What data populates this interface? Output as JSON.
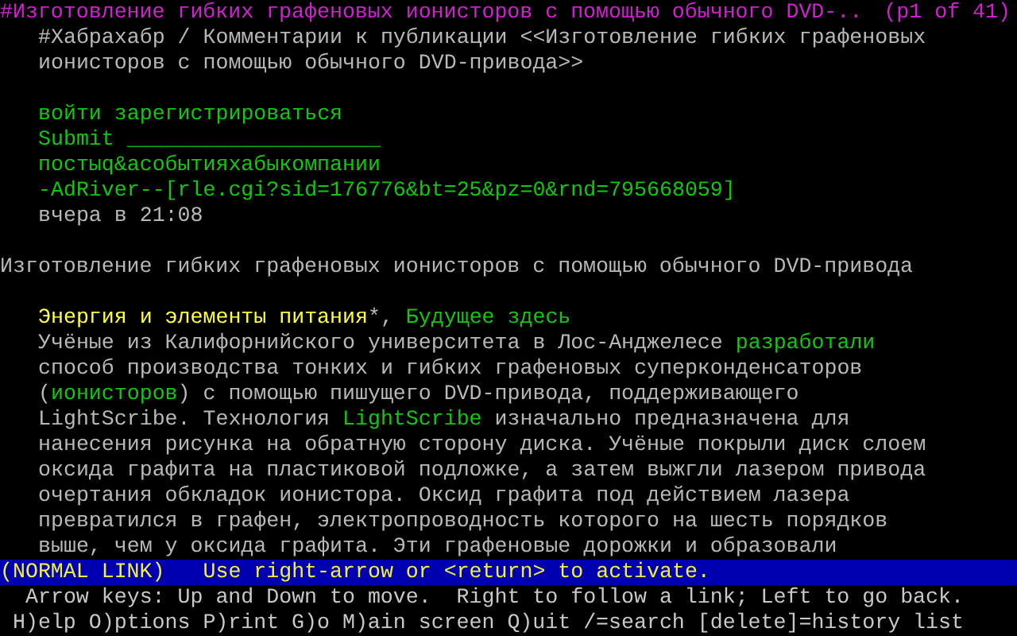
{
  "title_bar": {
    "title": "#Изготовление гибких графеновых ионисторов с помощью обычного DVD-..",
    "page": "(p1 of 41)"
  },
  "header": [
    "#Хабрахабр / Комментарии к публикации <<Изготовление гибких графеновых",
    "ионисторов с помощью обычного DVD-привода>>"
  ],
  "nav_lines": [
    [
      {
        "kind": "link",
        "text": "войти"
      },
      {
        "kind": "link",
        "text": "зарегистрироваться"
      }
    ],
    [
      {
        "kind": "link",
        "text": "Submit"
      },
      {
        "kind": "field",
        "text": "____________________"
      }
    ],
    [
      {
        "kind": "link",
        "text": "постыq&асобытияхабыкомпании"
      }
    ],
    [
      {
        "kind": "link",
        "text": "-AdRiver--[rle.cgi?sid=176776&bt=25&pz=0&rnd=795668059]"
      }
    ],
    [
      {
        "kind": "text",
        "text": "вчера в 21:08"
      }
    ]
  ],
  "heading": "Изготовление гибких графеновых ионисторов с помощью обычного DVD-привода",
  "article_lines": [
    [
      {
        "kind": "active-link",
        "text": "Энергия и элементы питания"
      },
      {
        "kind": "text",
        "text": "*, "
      },
      {
        "kind": "link",
        "text": "Будущее здесь"
      }
    ],
    [
      {
        "kind": "text",
        "text": "Учёные из Калифорнийского университета в Лос-Анджелесе "
      },
      {
        "kind": "link",
        "text": "разработали"
      }
    ],
    [
      {
        "kind": "text",
        "text": "способ производства тонких и гибких графеновых суперконденсаторов"
      }
    ],
    [
      {
        "kind": "text",
        "text": "("
      },
      {
        "kind": "link",
        "text": "ионисторов"
      },
      {
        "kind": "text",
        "text": ") с помощью пишущего DVD-привода, поддерживающего"
      }
    ],
    [
      {
        "kind": "text",
        "text": "LightScribe. Технология "
      },
      {
        "kind": "link",
        "text": "LightScribe"
      },
      {
        "kind": "text",
        "text": " изначально предназначена для"
      }
    ],
    [
      {
        "kind": "text",
        "text": "нанесения рисунка на обратную сторону диска. Учёные покрыли диск слоем"
      }
    ],
    [
      {
        "kind": "text",
        "text": "оксида графита на пластиковой подложке, а затем выжгли лазером привода"
      }
    ],
    [
      {
        "kind": "text",
        "text": "очертания обкладок ионистора. Оксид графита под действием лазера"
      }
    ],
    [
      {
        "kind": "text",
        "text": "превратился в графен, электропроводность которого на шесть порядков"
      }
    ],
    [
      {
        "kind": "text",
        "text": "выше, чем у оксида графита. Эти графеновые дорожки и образовали"
      }
    ]
  ],
  "status_bar": {
    "link_type": "(NORMAL LINK)",
    "message": "Use right-arrow or <return> to activate."
  },
  "help": [
    "Arrow keys: Up and Down to move.  Right to follow a link; Left to go back.",
    "H)elp O)ptions P)rint G)o M)ain screen Q)uit /=search [delete]=history list"
  ]
}
